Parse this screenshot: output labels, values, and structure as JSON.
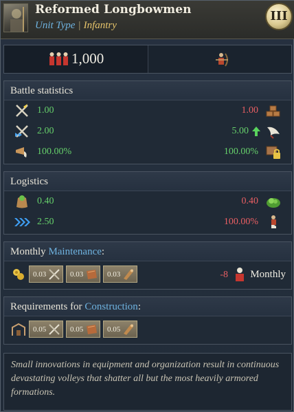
{
  "header": {
    "title": "Reformed Longbowmen",
    "unit_type_label": "Unit Type",
    "separator": "|",
    "unit_type_value": "Infantry",
    "tier": "III"
  },
  "manpower": {
    "value": "1,000"
  },
  "battle": {
    "title": "Battle statistics",
    "rows": [
      {
        "left": "1.00",
        "right": "1.00",
        "left_icon": "crossed-swords-icon",
        "right_icon": "bricks-icon"
      },
      {
        "left": "2.00",
        "right": "5.00",
        "left_icon": "charge-swords-icon",
        "right_icon": "wing-icon",
        "right_trend_icon": "green-up-arrow-icon"
      },
      {
        "left": "100.00%",
        "right": "100.00%",
        "left_icon": "morale-horn-icon",
        "right_icon": "lock-crate-icon"
      }
    ]
  },
  "logistics": {
    "title": "Logistics",
    "rows": [
      {
        "left": "0.40",
        "right": "0.40",
        "left_icon": "food-sack-icon",
        "right_icon": "green-supply-icon"
      },
      {
        "left": "2.50",
        "right": "100.00%",
        "left_icon": "blue-chevrons-icon",
        "right_icon": "soldier-boot-icon"
      }
    ]
  },
  "maintenance": {
    "title_prefix": "Monthly ",
    "title_link": "Maintenance",
    "title_suffix": ":",
    "costs": [
      {
        "value": "0.03",
        "icon": "weapons-icon"
      },
      {
        "value": "0.03",
        "icon": "leather-icon"
      },
      {
        "value": "0.03",
        "icon": "wood-icon"
      }
    ],
    "upkeep_value": "-8",
    "upkeep_label": "Monthly"
  },
  "construction": {
    "title_prefix": "Requirements for ",
    "title_link": "Construction",
    "title_suffix": ":",
    "costs": [
      {
        "value": "0.05",
        "icon": "weapons-icon"
      },
      {
        "value": "0.05",
        "icon": "leather-icon"
      },
      {
        "value": "0.05",
        "icon": "wood-icon"
      }
    ]
  },
  "description": "Small innovations in equipment and organization result in continuous devastating volleys that shatter all but the most heavily armored formations.",
  "colors": {
    "positive": "#66d06b",
    "negative": "#ea5f63",
    "link": "#6fb3e0",
    "gold": "#e7c56b"
  }
}
